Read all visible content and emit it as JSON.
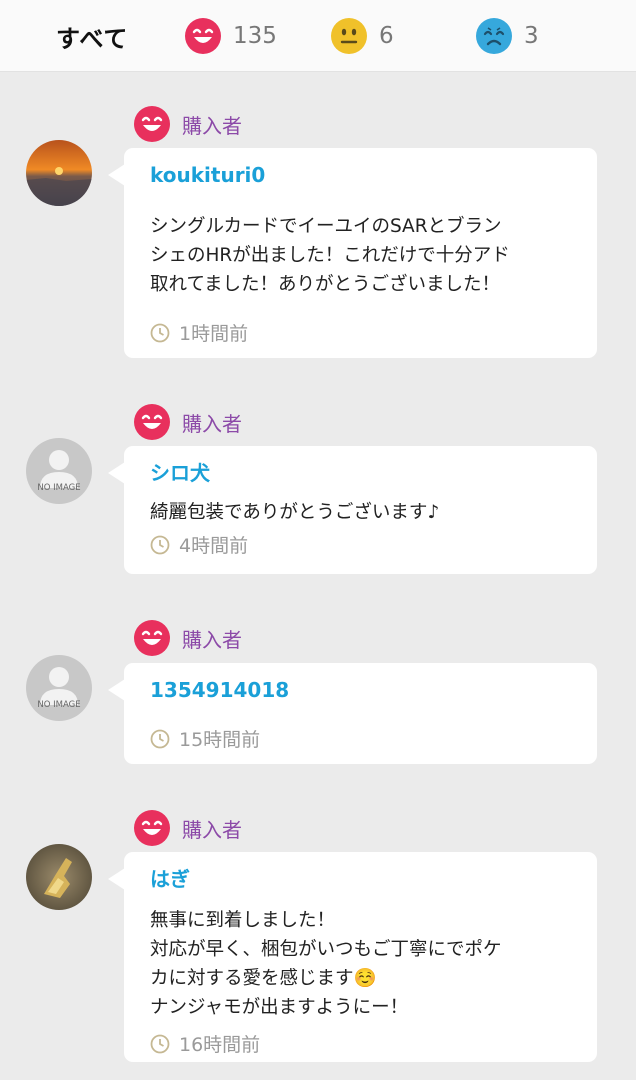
{
  "tabs": {
    "all_label": "すべて",
    "good_count": "135",
    "normal_count": "6",
    "bad_count": "3"
  },
  "colors": {
    "good": "#e8305d",
    "normal": "#f0c12a",
    "bad": "#36a8dc",
    "buyer_label": "#8c4aa8",
    "username": "#1aa0d8"
  },
  "reviews": [
    {
      "badge": "購入者",
      "rating_icon": "smile-face-icon",
      "avatar": "sunset-photo",
      "username": "koukituri0",
      "comment": "シングルカードでイーユイのSARとブラン\nシェのHRが出ました！これだけで十分アド\n取れてました！ありがとうございました！",
      "time": "1時間前"
    },
    {
      "badge": "購入者",
      "rating_icon": "smile-face-icon",
      "avatar": "no-image",
      "avatar_text": "NO IMAGE",
      "username": "シロ犬",
      "comment": "綺麗包装でありがとうございます♪",
      "time": "4時間前"
    },
    {
      "badge": "購入者",
      "rating_icon": "smile-face-icon",
      "avatar": "no-image",
      "avatar_text": "NO IMAGE",
      "username": "1354914018",
      "comment": "",
      "time": "15時間前"
    },
    {
      "badge": "購入者",
      "rating_icon": "smile-face-icon",
      "avatar": "gold-figure-photo",
      "username": "はぎ",
      "comment": "無事に到着しました！\n対応が早く、梱包がいつもご丁寧にでポケ\nカに対する愛を感じます☺️\nナンジャモが出ますようにー！",
      "time": "16時間前"
    }
  ]
}
